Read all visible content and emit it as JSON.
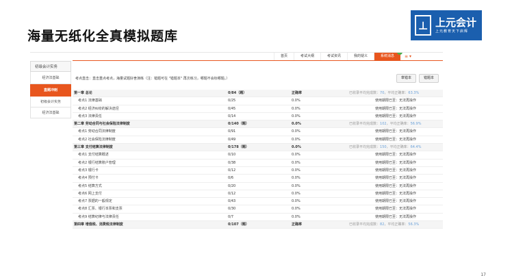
{
  "slide": {
    "title": "海量无纸化全真模拟题库",
    "page_number": "17"
  },
  "logo": {
    "name": "上元会计",
    "slogan": "上元教育天下启辉"
  },
  "sidebar": {
    "items": [
      {
        "label": "初级会计实务",
        "type": "header"
      },
      {
        "label": "经济法基础",
        "type": "item"
      },
      {
        "label": "直题冲刺",
        "type": "active"
      },
      {
        "label": "初级会计实务",
        "type": "sub"
      },
      {
        "label": "经济法基础",
        "type": "sub"
      }
    ]
  },
  "topnav": {
    "tabs": [
      "首页",
      "考试大纲",
      "考试资讯",
      "我的疑义",
      "系统消息"
    ],
    "badge": "0",
    "menu_icon": "≡ ▾"
  },
  "notice": "考点直击：直击重点考点，海量试题好舍演练（注：错题可在 \"错题本\" 再次练习，哪题不会标哪题。）",
  "buttons": {
    "mistakes": "章错本",
    "notes": "错题本"
  },
  "rows": [
    {
      "type": "chapter",
      "name": "第一章 总论",
      "count": "0/84（题）",
      "rate": "正确率",
      "stats_prefix": "已收录平均完成数：",
      "stats_count": "70",
      "stats_mid": "，平均正确率：",
      "stats_rate": "63.3%"
    },
    {
      "type": "point",
      "name": "考点1 法律基础",
      "count": "0/25",
      "rate": "0.0%",
      "note": "使用期限已至：无法再操作"
    },
    {
      "type": "point",
      "name": "考点2 经济纠纷的解决途径",
      "count": "0/45",
      "rate": "0.0%",
      "note": "使用期限已至：无法再操作"
    },
    {
      "type": "point",
      "name": "考点3 法律责任",
      "count": "0/14",
      "rate": "0.0%",
      "note": "使用期限已至：无法再操作"
    },
    {
      "type": "chapter",
      "name": "第二章 劳动合同与社会保险法律制度",
      "count": "0/140（题）",
      "rate": "0.0%",
      "stats_prefix": "已收录平均完成数：",
      "stats_count": "102",
      "stats_mid": "，平均正确率：",
      "stats_rate": "56.9%"
    },
    {
      "type": "point",
      "name": "考点1 劳动合同法律制度",
      "count": "0/91",
      "rate": "0.0%",
      "note": "使用期限已至：无法再操作"
    },
    {
      "type": "point",
      "name": "考点2 社会保险法律制度",
      "count": "0/49",
      "rate": "0.0%",
      "note": "使用期限已至：无法再操作"
    },
    {
      "type": "chapter",
      "name": "第三章 支付结算法律制度",
      "count": "0/178（题）",
      "rate": "0.0%",
      "stats_prefix": "已收录平均完成数：",
      "stats_count": "150",
      "stats_mid": "，平均正确率：",
      "stats_rate": "64.4%"
    },
    {
      "type": "point",
      "name": "考点1 支付结算概述",
      "count": "0/10",
      "rate": "0.0%",
      "note": "使用期限已至：无法再操作"
    },
    {
      "type": "point",
      "name": "考点2 银行结算账户管理",
      "count": "0/38",
      "rate": "0.0%",
      "note": "使用期限已至：无法再操作"
    },
    {
      "type": "point",
      "name": "考点3 银行卡",
      "count": "0/12",
      "rate": "0.0%",
      "note": "使用期限已至：无法再操作"
    },
    {
      "type": "point",
      "name": "考点4 预付卡",
      "count": "0/6",
      "rate": "0.0%",
      "note": "使用期限已至：无法再操作"
    },
    {
      "type": "point",
      "name": "考点5 结算方式",
      "count": "0/20",
      "rate": "0.0%",
      "note": "使用期限已至：无法再操作"
    },
    {
      "type": "point",
      "name": "考点6 网上支付",
      "count": "0/12",
      "rate": "0.0%",
      "note": "使用期限已至：无法再操作"
    },
    {
      "type": "point",
      "name": "考点7 票据的一般规定",
      "count": "0/43",
      "rate": "0.0%",
      "note": "使用期限已至：无法再操作"
    },
    {
      "type": "point",
      "name": "考点8 汇票、银行本票和支票",
      "count": "0/30",
      "rate": "0.0%",
      "note": "使用期限已至：无法再操作"
    },
    {
      "type": "point",
      "name": "考点9 结算纪律与法律责任",
      "count": "0/7",
      "rate": "0.0%",
      "note": "使用期限已至：无法再操作"
    },
    {
      "type": "chapter",
      "name": "第四章 增值税、消费税法律制度",
      "count": "0/107（题）",
      "rate": "正确率",
      "stats_prefix": "已收录平均完成数：",
      "stats_count": "82",
      "stats_mid": "，平均正确率：",
      "stats_rate": "56.3%"
    }
  ]
}
